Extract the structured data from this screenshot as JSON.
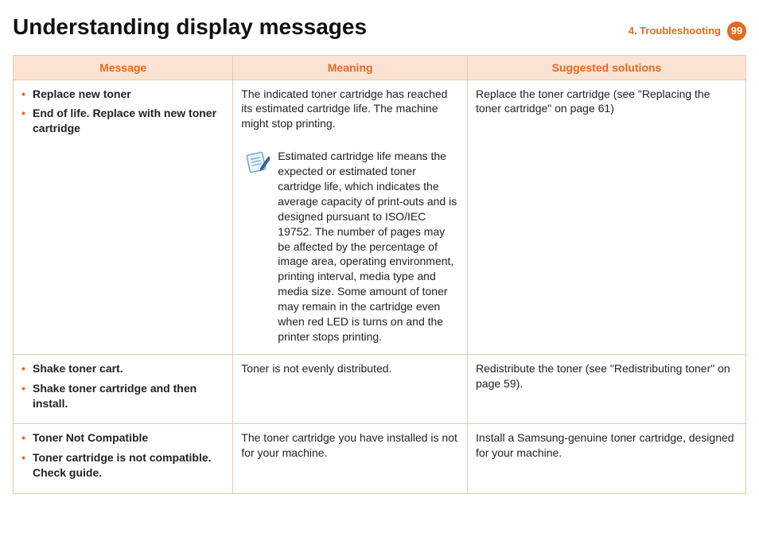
{
  "header": {
    "title": "Understanding display messages",
    "section_label": "4.  Troubleshooting",
    "page_number": "99"
  },
  "table": {
    "headers": [
      "Message",
      "Meaning",
      "Suggested solutions"
    ],
    "rows": [
      {
        "messages": [
          "Replace new toner",
          "End of life. Replace with new toner cartridge"
        ],
        "meaning": "The indicated toner cartridge has reached its estimated cartridge life. The machine might stop printing.",
        "note": "Estimated cartridge life means the expected or estimated toner cartridge life, which indicates the average capacity of print-outs and is designed pursuant to ISO/IEC 19752. The number of pages may be affected by the percentage of image area, operating environment, printing interval, media type and media size. Some amount of toner may remain in the cartridge even when red LED is turns on and the printer stops printing.",
        "solution": "Replace the toner cartridge (see \"Replacing the toner cartridge\" on page 61)"
      },
      {
        "messages": [
          "Shake toner cart.",
          "Shake toner cartridge and then install."
        ],
        "meaning": "Toner is not evenly distributed.",
        "solution": "Redistribute the toner (see \"Redistributing toner\" on page 59)."
      },
      {
        "messages": [
          "Toner Not Compatible",
          "Toner cartridge is not compatible. Check guide."
        ],
        "meaning": "The toner cartridge you have installed is not for your machine.",
        "solution": "Install a Samsung-genuine toner cartridge, designed for your machine."
      }
    ]
  }
}
